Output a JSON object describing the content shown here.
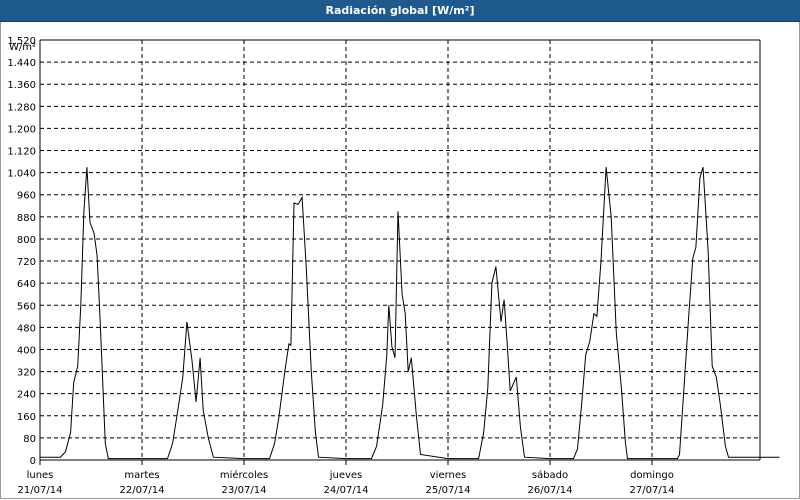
{
  "window": {
    "title": "Radiación global [W/m²]"
  },
  "colors": {
    "titlebar": "#1e5a8e",
    "line": "#000000",
    "grid": "#000000",
    "background": "#ffffff"
  },
  "chart_data": {
    "type": "line",
    "title": "Radiación global [W/m²]",
    "ylabel": "W/m²",
    "ylim": [
      0,
      1520
    ],
    "yticks": [
      "1.520",
      "1.440",
      "1.360",
      "1.280",
      "1.200",
      "1.120",
      "1.040",
      "960",
      "880",
      "800",
      "720",
      "640",
      "560",
      "480",
      "400",
      "320",
      "240",
      "160",
      "80",
      "0"
    ],
    "grid": true,
    "xlim": [
      0,
      7.3
    ],
    "days": [
      {
        "name": "lunes",
        "date": "21/07/14"
      },
      {
        "name": "martes",
        "date": "22/07/14"
      },
      {
        "name": "miércoles",
        "date": "23/07/14"
      },
      {
        "name": "jueves",
        "date": "24/07/14"
      },
      {
        "name": "viernes",
        "date": "25/07/14"
      },
      {
        "name": "sábado",
        "date": "26/07/14"
      },
      {
        "name": "domingo",
        "date": "27/07/14"
      }
    ],
    "series": [
      {
        "points": [
          [
            0.0,
            10
          ],
          [
            0.2,
            10
          ],
          [
            0.25,
            30
          ],
          [
            0.3,
            100
          ],
          [
            0.33,
            280
          ],
          [
            0.37,
            340
          ],
          [
            0.4,
            560
          ],
          [
            0.43,
            900
          ],
          [
            0.46,
            1060
          ],
          [
            0.49,
            860
          ],
          [
            0.53,
            820
          ],
          [
            0.56,
            740
          ],
          [
            0.59,
            500
          ],
          [
            0.62,
            240
          ],
          [
            0.64,
            60
          ],
          [
            0.67,
            5
          ],
          [
            1.0,
            5
          ],
          [
            1.25,
            5
          ],
          [
            1.3,
            60
          ],
          [
            1.36,
            200
          ],
          [
            1.4,
            300
          ],
          [
            1.44,
            500
          ],
          [
            1.49,
            360
          ],
          [
            1.53,
            210
          ],
          [
            1.57,
            370
          ],
          [
            1.6,
            180
          ],
          [
            1.65,
            80
          ],
          [
            1.7,
            10
          ],
          [
            2.0,
            5
          ],
          [
            2.25,
            5
          ],
          [
            2.3,
            60
          ],
          [
            2.34,
            150
          ],
          [
            2.4,
            320
          ],
          [
            2.44,
            420
          ],
          [
            2.46,
            415
          ],
          [
            2.49,
            930
          ],
          [
            2.53,
            925
          ],
          [
            2.57,
            950
          ],
          [
            2.61,
            700
          ],
          [
            2.66,
            320
          ],
          [
            2.7,
            100
          ],
          [
            2.73,
            10
          ],
          [
            3.0,
            5
          ],
          [
            3.25,
            5
          ],
          [
            3.3,
            50
          ],
          [
            3.36,
            200
          ],
          [
            3.4,
            380
          ],
          [
            3.42,
            560
          ],
          [
            3.45,
            410
          ],
          [
            3.48,
            370
          ],
          [
            3.51,
            900
          ],
          [
            3.55,
            600
          ],
          [
            3.58,
            530
          ],
          [
            3.61,
            320
          ],
          [
            3.64,
            370
          ],
          [
            3.69,
            160
          ],
          [
            3.73,
            20
          ],
          [
            4.0,
            5
          ],
          [
            4.3,
            5
          ],
          [
            4.35,
            100
          ],
          [
            4.39,
            260
          ],
          [
            4.43,
            640
          ],
          [
            4.47,
            700
          ],
          [
            4.52,
            500
          ],
          [
            4.55,
            580
          ],
          [
            4.58,
            420
          ],
          [
            4.61,
            250
          ],
          [
            4.67,
            300
          ],
          [
            4.71,
            120
          ],
          [
            4.75,
            10
          ],
          [
            5.0,
            5
          ],
          [
            5.23,
            5
          ],
          [
            5.27,
            40
          ],
          [
            5.31,
            200
          ],
          [
            5.35,
            380
          ],
          [
            5.39,
            430
          ],
          [
            5.43,
            530
          ],
          [
            5.46,
            520
          ],
          [
            5.5,
            720
          ],
          [
            5.55,
            1060
          ],
          [
            5.6,
            880
          ],
          [
            5.65,
            460
          ],
          [
            5.7,
            260
          ],
          [
            5.74,
            60
          ],
          [
            5.76,
            5
          ],
          [
            6.0,
            5
          ],
          [
            6.25,
            5
          ],
          [
            6.27,
            20
          ],
          [
            6.31,
            240
          ],
          [
            6.36,
            520
          ],
          [
            6.4,
            730
          ],
          [
            6.43,
            770
          ],
          [
            6.47,
            1020
          ],
          [
            6.5,
            1060
          ],
          [
            6.55,
            760
          ],
          [
            6.59,
            340
          ],
          [
            6.63,
            300
          ],
          [
            6.67,
            200
          ],
          [
            6.72,
            50
          ],
          [
            6.75,
            10
          ],
          [
            7.0,
            10
          ],
          [
            7.25,
            10
          ]
        ]
      }
    ]
  }
}
